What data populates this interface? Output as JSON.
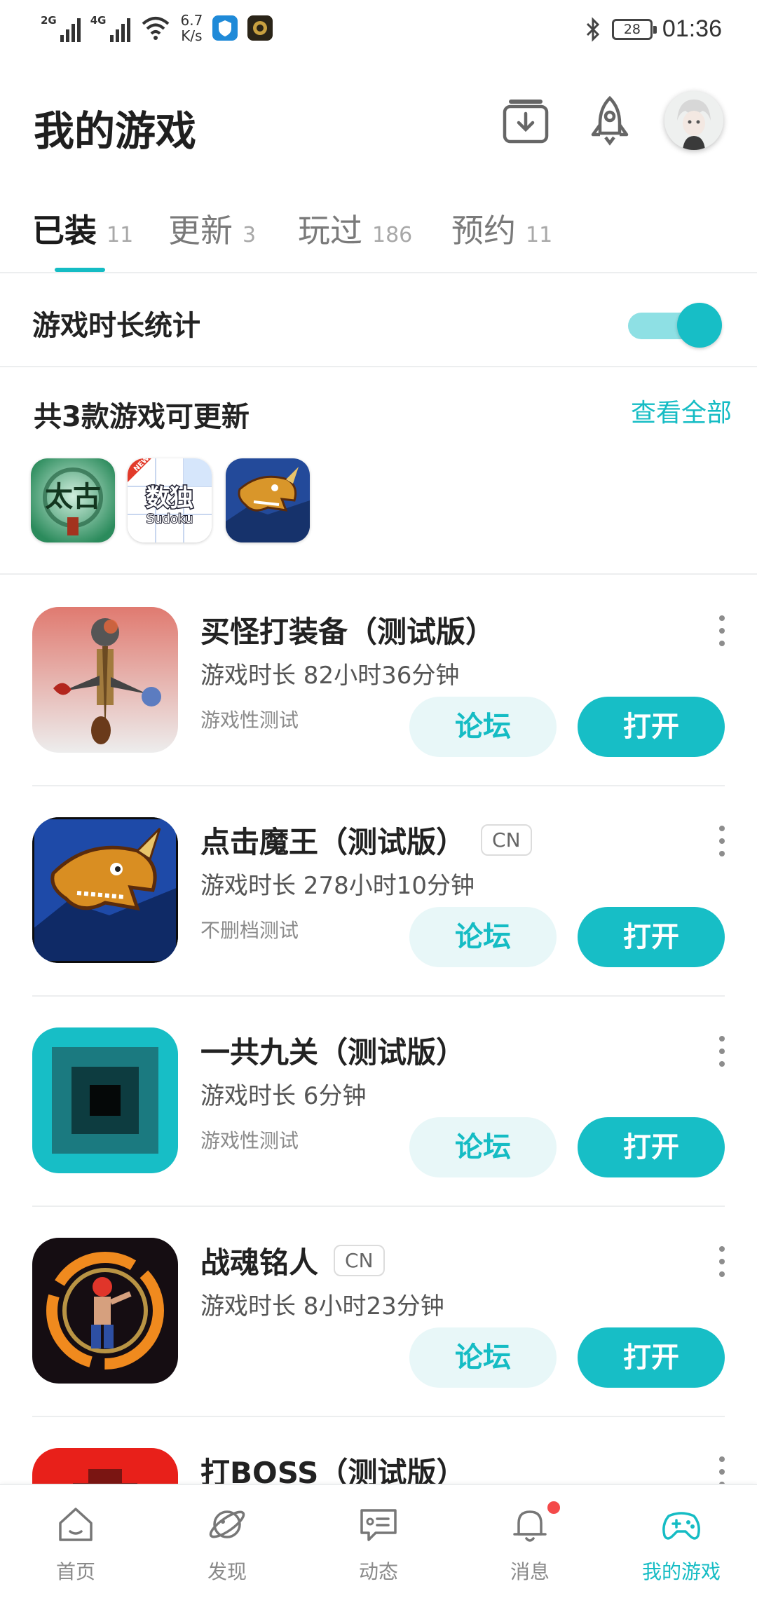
{
  "status_bar": {
    "signal1_tag": "2G",
    "signal2_tag": "4G",
    "speed_value": "6.7",
    "speed_unit": "K/s",
    "battery": "28",
    "time": "01:36"
  },
  "header": {
    "title": "我的游戏"
  },
  "tabs": [
    {
      "label": "已装",
      "count": "11"
    },
    {
      "label": "更新",
      "count": "3"
    },
    {
      "label": "玩过",
      "count": "186"
    },
    {
      "label": "预约",
      "count": "11"
    }
  ],
  "stats": {
    "label": "游戏时长统计",
    "enabled": true
  },
  "updates": {
    "title": "共3款游戏可更新",
    "view_all": "查看全部",
    "icon1_text": "太古",
    "icon2_text": "数独",
    "icon2_sub": "Sudoku",
    "icon2_badge": "NEW"
  },
  "games": [
    {
      "name": "买怪打装备（测试版）",
      "cn": "",
      "time": "游戏时长 82小时36分钟",
      "tag": "游戏性测试",
      "forum": "论坛",
      "open": "打开"
    },
    {
      "name": "点击魔王（测试版）",
      "cn": "CN",
      "time": "游戏时长 278小时10分钟",
      "tag": "不删档测试",
      "forum": "论坛",
      "open": "打开"
    },
    {
      "name": "一共九关（测试版）",
      "cn": "",
      "time": "游戏时长 6分钟",
      "tag": "游戏性测试",
      "forum": "论坛",
      "open": "打开"
    },
    {
      "name": "战魂铭人",
      "cn": "CN",
      "time": "游戏时长 8小时23分钟",
      "tag": "",
      "forum": "论坛",
      "open": "打开"
    },
    {
      "name": "打BOSS（测试版）",
      "cn": "",
      "time": "",
      "tag": "",
      "forum": "",
      "open": ""
    }
  ],
  "bottom_nav": [
    {
      "label": "首页",
      "icon": "home-icon"
    },
    {
      "label": "发现",
      "icon": "planet-icon"
    },
    {
      "label": "动态",
      "icon": "chat-icon"
    },
    {
      "label": "消息",
      "icon": "bell-icon"
    },
    {
      "label": "我的游戏",
      "icon": "gamepad-icon"
    }
  ],
  "colors": {
    "accent": "#17bec6",
    "accent_light": "#e8f7f8",
    "badge": "#f44a4a"
  }
}
